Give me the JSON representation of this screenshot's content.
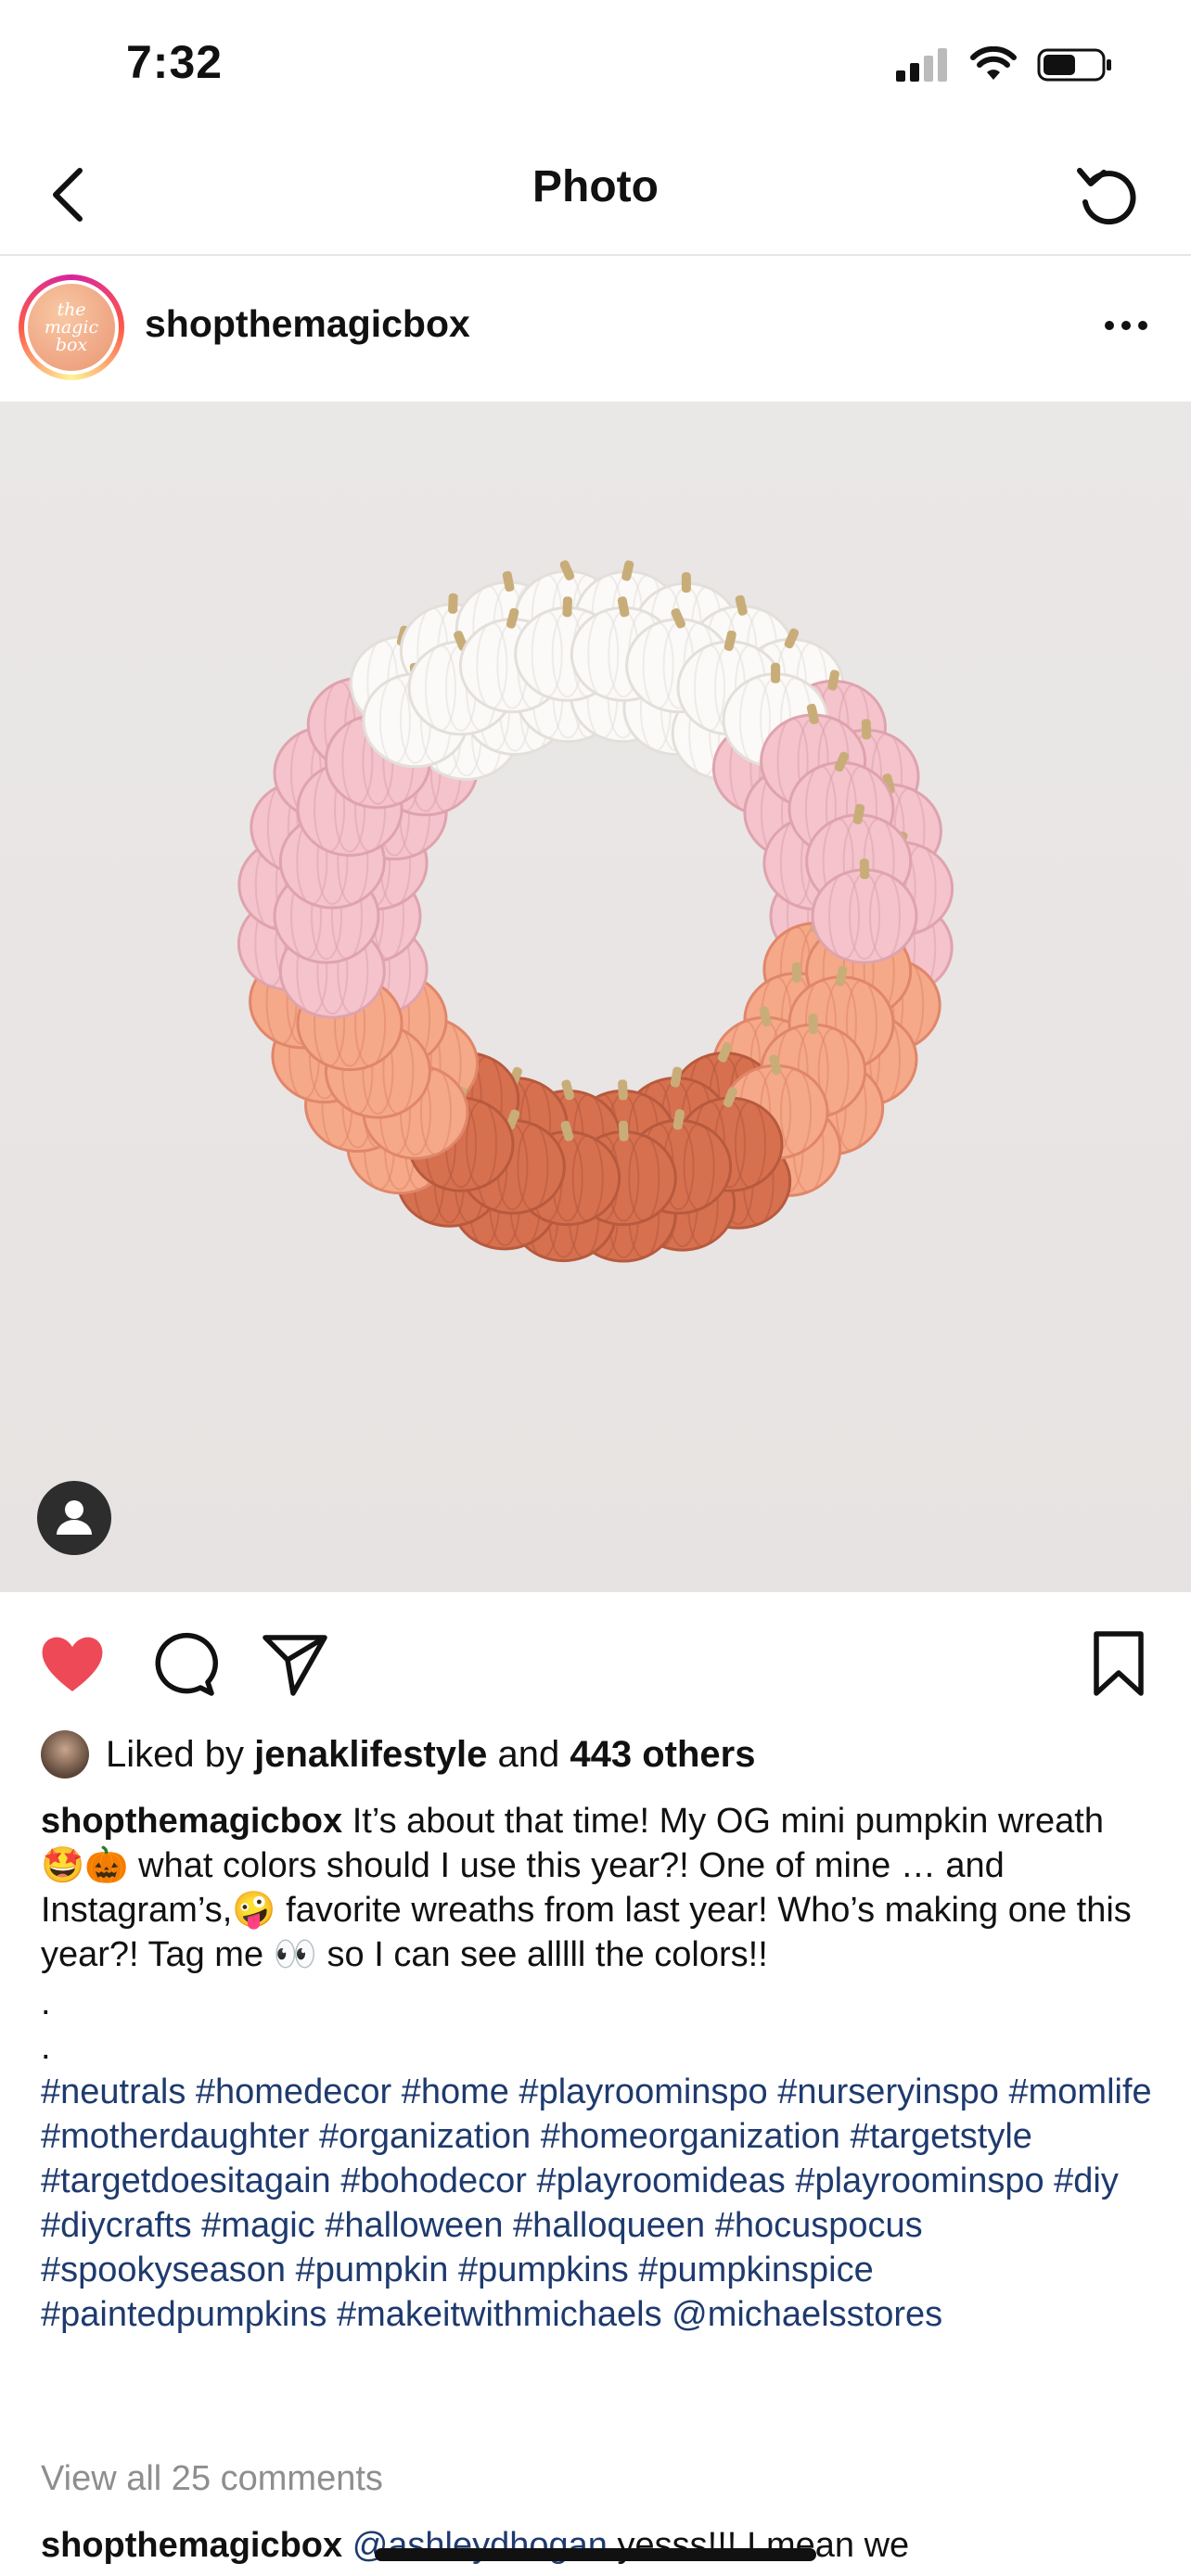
{
  "status_bar": {
    "time": "7:32"
  },
  "nav": {
    "title": "Photo"
  },
  "post": {
    "username": "shopthemagicbox",
    "avatar_text": "the magic box"
  },
  "likes": {
    "prefix": "Liked by",
    "user": "jenaklifestyle",
    "middle": "and",
    "others": "443 others"
  },
  "caption": {
    "username": "shopthemagicbox",
    "text": "It’s about that time! My OG mini pumpkin wreath 🤩🎃 what colors should I use this year?! One of mine … and Instagram’s,🤪 favorite wreaths from last year! Who’s making one this year?! Tag me 👀 so I can see alllll the colors!!",
    "dot1": ".",
    "dot2": ".",
    "hashtags": "#neutrals #homedecor #home  #playroominspo #nurseryinspo #momlife #motherdaughter #organization #homeorganization #targetstyle #targetdoesitagain #bohodecor #playroomideas #playroominspo #diy #diycrafts #magic #halloween #halloqueen #hocuspocus #spookyseason #pumpkin #pumpkins #pumpkinspice #paintedpumpkins #makeitwithmichaels @michaelsstores"
  },
  "view_comments": "View all 25 comments",
  "comment": {
    "username": "shopthemagicbox",
    "mention": "@ashleydhogan",
    "text": "yesss!!! I mean we"
  },
  "icons": {
    "back": "chevron-left-icon",
    "refresh": "refresh-icon",
    "more": "more-icon",
    "like": "heart-icon",
    "comment": "comment-icon",
    "share": "send-icon",
    "save": "bookmark-icon",
    "tag": "person-tag-icon"
  },
  "colors": {
    "like": "#ed4956",
    "hashtag": "#1e3a6e",
    "muted": "#8e8e8e"
  }
}
